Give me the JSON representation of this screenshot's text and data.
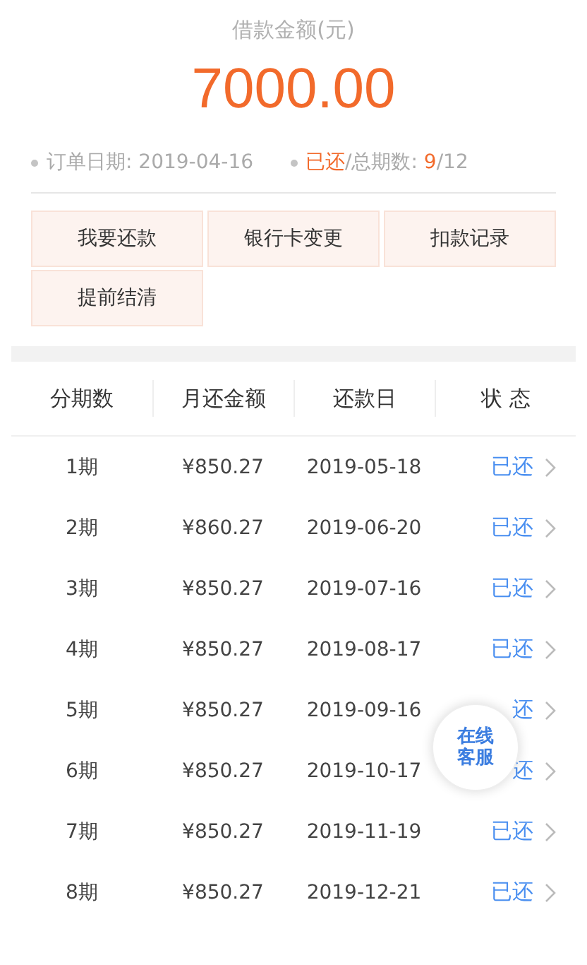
{
  "loan": {
    "label": "借款金额(元)",
    "amount": "7000.00"
  },
  "summary": [
    {
      "text": "订单日期: 2019-04-16"
    },
    {
      "text": "**已还**/总期数: **9**/12"
    }
  ],
  "actions": [
    "我要还款",
    "银行卡变更",
    "扣款记录",
    "提前结清"
  ],
  "table": {
    "columns": [
      "分期数",
      "月还金额",
      "还款日",
      "状 态"
    ],
    "rows": [
      {
        "period": "1期",
        "amount": "¥850.27",
        "date": "2019-05-18",
        "status": "已还"
      },
      {
        "period": "2期",
        "amount": "¥860.27",
        "date": "2019-06-20",
        "status": "已还"
      },
      {
        "period": "3期",
        "amount": "¥850.27",
        "date": "2019-07-16",
        "status": "已还"
      },
      {
        "period": "4期",
        "amount": "¥850.27",
        "date": "2019-08-17",
        "status": "已还"
      },
      {
        "period": "5期",
        "amount": "¥850.27",
        "date": "2019-09-16",
        "status": "还"
      },
      {
        "period": "6期",
        "amount": "¥850.27",
        "date": "2019-10-17",
        "status": "还"
      },
      {
        "period": "7期",
        "amount": "¥850.27",
        "date": "2019-11-19",
        "status": "已还"
      },
      {
        "period": "8期",
        "amount": "¥850.27",
        "date": "2019-12-21",
        "status": "已还"
      }
    ]
  },
  "chat_button": {
    "line_1": "在线",
    "line_2": "客服"
  }
}
